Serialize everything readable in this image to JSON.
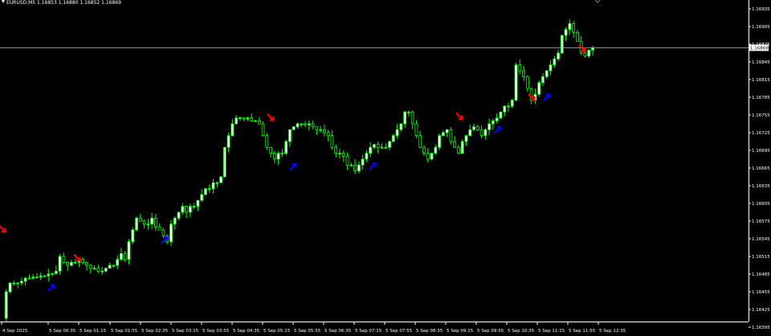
{
  "header": {
    "symbol_line": "EURUSD,M5  1.16853 1.16880 1.16852 1.16869"
  },
  "bid_label": "1.16869",
  "colors": {
    "background": "#000000",
    "candle": "#00ff00",
    "candle_up_fill": "#ffffff",
    "axis": "#ffffff",
    "bid_line": "#b4b4b4",
    "sell_arrow": "#ff0000",
    "buy_arrow": "#0000ff"
  },
  "chart_data": {
    "type": "candlestick",
    "price_axis": {
      "min": 1.16395,
      "max": 1.16935,
      "ticks": [
        "1.16935",
        "1.16905",
        "1.16875",
        "1.16845",
        "1.16815",
        "1.16785",
        "1.16755",
        "1.16725",
        "1.16695",
        "1.16665",
        "1.16635",
        "1.16605",
        "1.16575",
        "1.16545",
        "1.16515",
        "1.16485",
        "1.16455",
        "1.16425",
        "1.16395"
      ]
    },
    "time_axis": {
      "labels": [
        "4 Sep 2025",
        "5 Sep 00:35",
        "5 Sep 01:15",
        "5 Sep 01:55",
        "5 Sep 02:35",
        "5 Sep 03:15",
        "5 Sep 03:55",
        "5 Sep 04:35",
        "5 Sep 05:15",
        "5 Sep 05:55",
        "5 Sep 06:35",
        "5 Sep 07:15",
        "5 Sep 07:55",
        "5 Sep 08:35",
        "5 Sep 09:15",
        "5 Sep 09:55",
        "5 Sep 10:35",
        "5 Sep 11:15",
        "5 Sep 11:55",
        "5 Sep 12:35"
      ]
    },
    "bid": 1.16869,
    "path": [
      1.1641,
      1.16455,
      1.1647,
      1.1647,
      1.1647,
      1.16473,
      1.16478,
      1.16478,
      1.1648,
      1.1648,
      1.16482,
      1.16482,
      1.16485,
      1.16486,
      1.1649,
      1.16515,
      1.16505,
      1.165,
      1.16505,
      1.16505,
      1.1651,
      1.16505,
      1.165,
      1.16495,
      1.16495,
      1.1649,
      1.1649,
      1.16495,
      1.165,
      1.165,
      1.1651,
      1.1652,
      1.1651,
      1.1654,
      1.1656,
      1.1658,
      1.16575,
      1.1657,
      1.1657,
      1.1658,
      1.16565,
      1.1656,
      1.1655,
      1.1654,
      1.1657,
      1.1658,
      1.1659,
      1.166,
      1.1659,
      1.166,
      1.166,
      1.1661,
      1.1662,
      1.1663,
      1.1663,
      1.1664,
      1.1664,
      1.1665,
      1.167,
      1.1672,
      1.1674,
      1.1675,
      1.1675,
      1.16748,
      1.1675,
      1.16745,
      1.16745,
      1.1674,
      1.1672,
      1.167,
      1.1669,
      1.1668,
      1.1669,
      1.1669,
      1.1671,
      1.1673,
      1.16735,
      1.1674,
      1.1674,
      1.16738,
      1.1674,
      1.16735,
      1.1673,
      1.1673,
      1.16725,
      1.1672,
      1.167,
      1.1669,
      1.1669,
      1.16685,
      1.1667,
      1.1667,
      1.1666,
      1.1667,
      1.1668,
      1.1669,
      1.167,
      1.16705,
      1.167,
      1.167,
      1.167,
      1.1671,
      1.1672,
      1.1673,
      1.1674,
      1.1676,
      1.1676,
      1.1674,
      1.1672,
      1.167,
      1.1669,
      1.1668,
      1.1669,
      1.167,
      1.1672,
      1.16725,
      1.1673,
      1.1671,
      1.167,
      1.1669,
      1.1671,
      1.1672,
      1.1673,
      1.16735,
      1.1673,
      1.1672,
      1.1673,
      1.1674,
      1.16745,
      1.1675,
      1.1676,
      1.1677,
      1.1677,
      1.1678,
      1.1684,
      1.1683,
      1.1682,
      1.168,
      1.1678,
      1.1679,
      1.1681,
      1.1682,
      1.1683,
      1.1684,
      1.1685,
      1.1686,
      1.1689,
      1.169,
      1.1691,
      1.16895,
      1.1688,
      1.1686,
      1.16855,
      1.16865,
      1.16869
    ],
    "signals": [
      {
        "type": "sell",
        "price": 1.16562
      },
      {
        "type": "buy",
        "price": 1.16462
      },
      {
        "type": "sell",
        "price": 1.16513
      },
      {
        "type": "buy",
        "price": 1.16543
      },
      {
        "type": "sell",
        "price": 1.16751
      },
      {
        "type": "buy",
        "price": 1.16667
      },
      {
        "type": "buy",
        "price": 1.16668
      },
      {
        "type": "sell",
        "price": 1.16753
      },
      {
        "type": "buy",
        "price": 1.1673
      },
      {
        "type": "sell",
        "price": 1.16785
      },
      {
        "type": "buy",
        "price": 1.16785
      },
      {
        "type": "sell",
        "price": 1.16868
      }
    ]
  }
}
